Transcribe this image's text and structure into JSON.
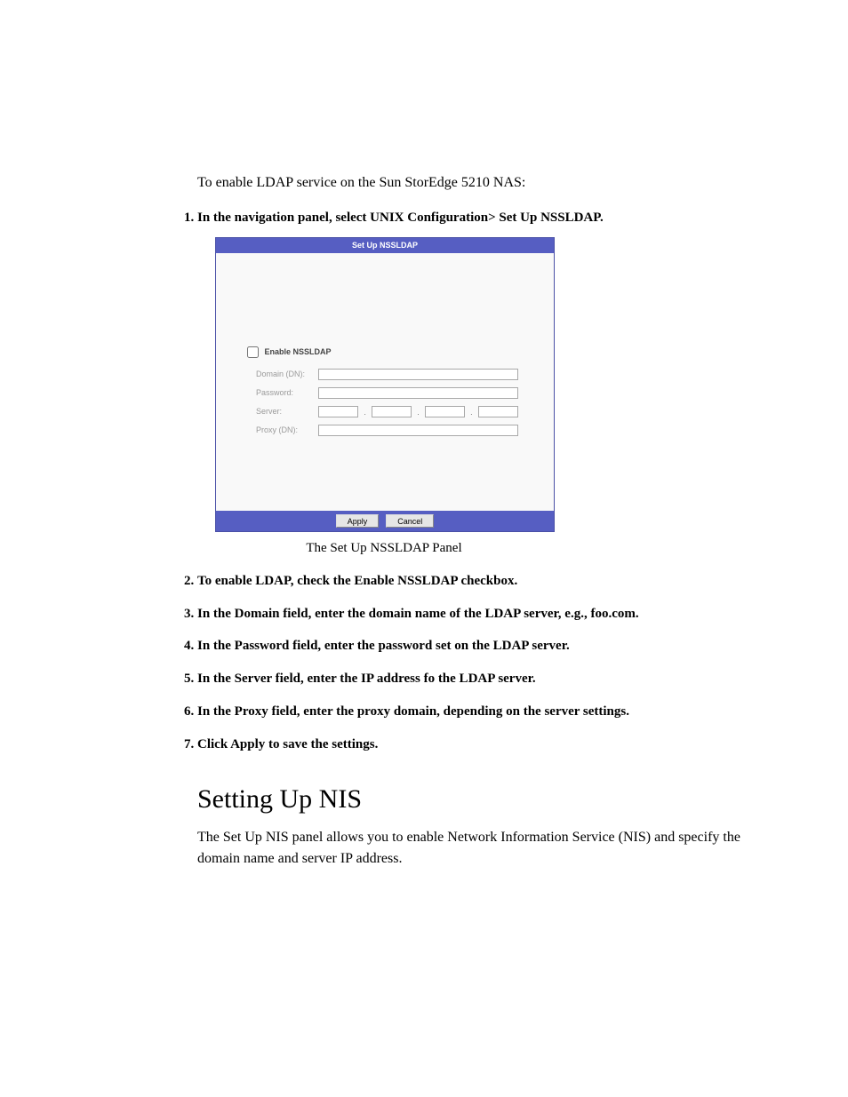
{
  "intro": "To enable LDAP service on the Sun StorEdge 5210 NAS:",
  "steps": {
    "s1": "In the navigation panel, select UNIX Configuration> Set Up NSSLDAP.",
    "s2": "To enable LDAP, check the Enable NSSLDAP checkbox.",
    "s3": "In the Domain field, enter the domain name of the LDAP server, e.g., foo.com.",
    "s4": "In the Password field, enter the password set on the LDAP server.",
    "s5": "In the Server field, enter the IP address fo the LDAP server.",
    "s6": "In the Proxy field, enter the proxy domain, depending on the server settings.",
    "s7": "Click Apply to save the settings."
  },
  "panel": {
    "title": "Set Up NSSLDAP",
    "enable_label": "Enable NSSLDAP",
    "labels": {
      "domain": "Domain (DN):",
      "password": "Password:",
      "server": "Server:",
      "proxy": "Proxy (DN):"
    },
    "buttons": {
      "apply": "Apply",
      "cancel": "Cancel"
    }
  },
  "figure_caption": "The Set Up NSSLDAP Panel",
  "section": {
    "heading": "Setting Up NIS",
    "body": "The Set Up NIS panel allows you to enable Network Information Service (NIS) and specify the domain name and server IP address."
  }
}
